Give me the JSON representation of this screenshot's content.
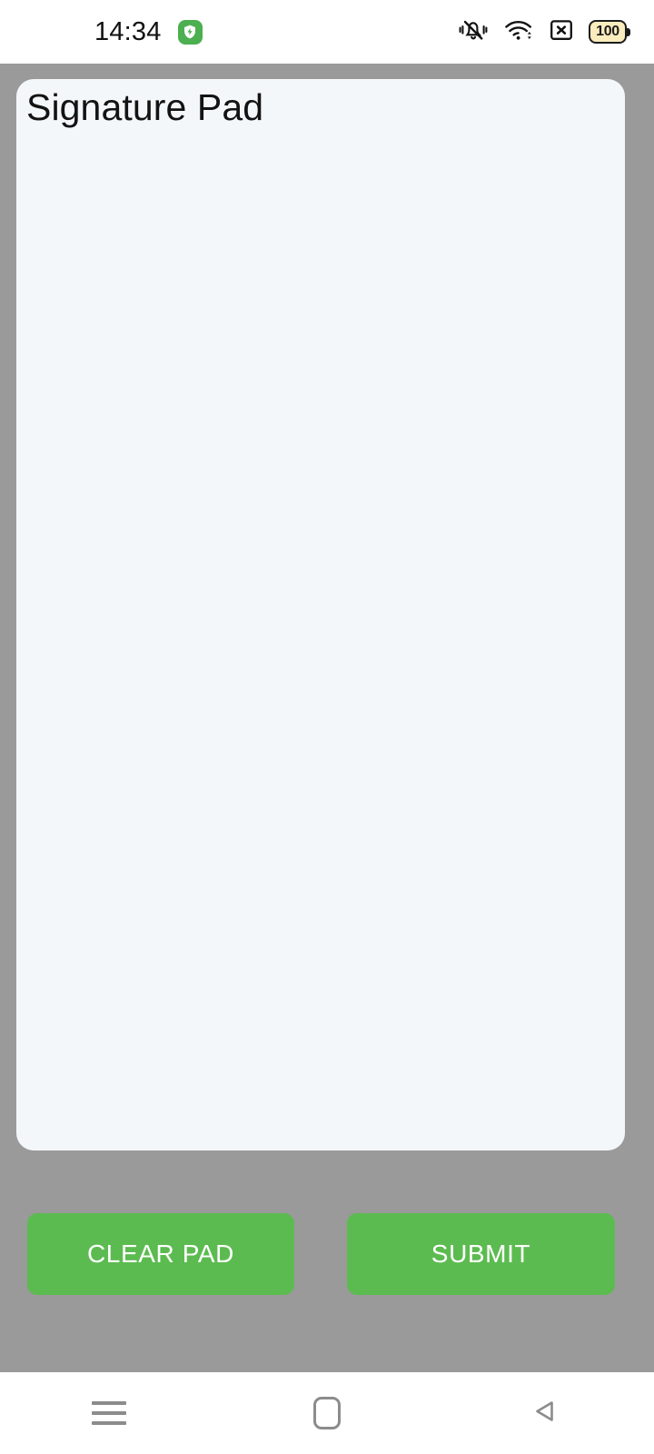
{
  "status_bar": {
    "clock": "14:34",
    "app_badge_icon": "green-shield-bolt-icon",
    "icons": [
      "vibrate-bell-off-icon",
      "wifi-icon",
      "no-sim-x-box-icon"
    ],
    "battery_level": "100"
  },
  "app": {
    "card": {
      "title": "Signature Pad",
      "canvas_name": "signature-drawing-area",
      "background_color": "#F4F7FA"
    },
    "backdrop_color": "#9A9A9A",
    "accent_color": "#5CBB50",
    "buttons": {
      "clear": "CLEAR PAD",
      "submit": "SUBMIT"
    }
  },
  "navigation_bar": {
    "recents_label": "recents-menu-icon",
    "home_label": "home-icon",
    "back_label": "back-icon"
  }
}
